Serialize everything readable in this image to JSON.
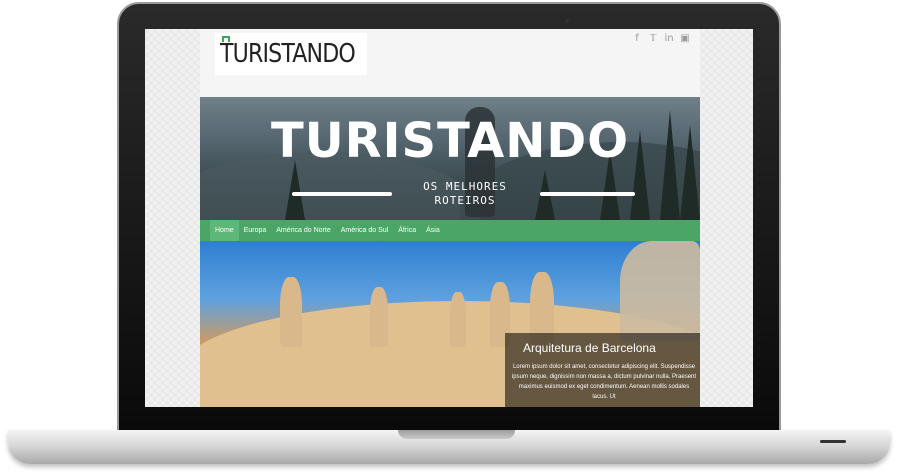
{
  "site": {
    "logo_text": "TURISTANDO",
    "social": [
      "f",
      "t",
      "in",
      "ig"
    ],
    "hero": {
      "title": "TURISTANDO",
      "subtitle_line1": "OS MELHORES",
      "subtitle_line2": "ROTEIROS"
    },
    "nav": [
      "Home",
      "Europa",
      "América do Norte",
      "América do Sul",
      "África",
      "Ásia"
    ],
    "slide": {
      "title": "Arquitetura de Barcelona",
      "text": "Lorem ipsum dolor sit amet, consectetur adipiscing elit. Suspendisse ipsum neque, dignissim non massa a, dictum pulvinar nulla. Praesent maximus euismod ex eget condimentum. Aenean mollis sodales lacus. Ut"
    }
  },
  "colors": {
    "nav_green": "#4aa566",
    "logo_green": "#3fa35a"
  }
}
